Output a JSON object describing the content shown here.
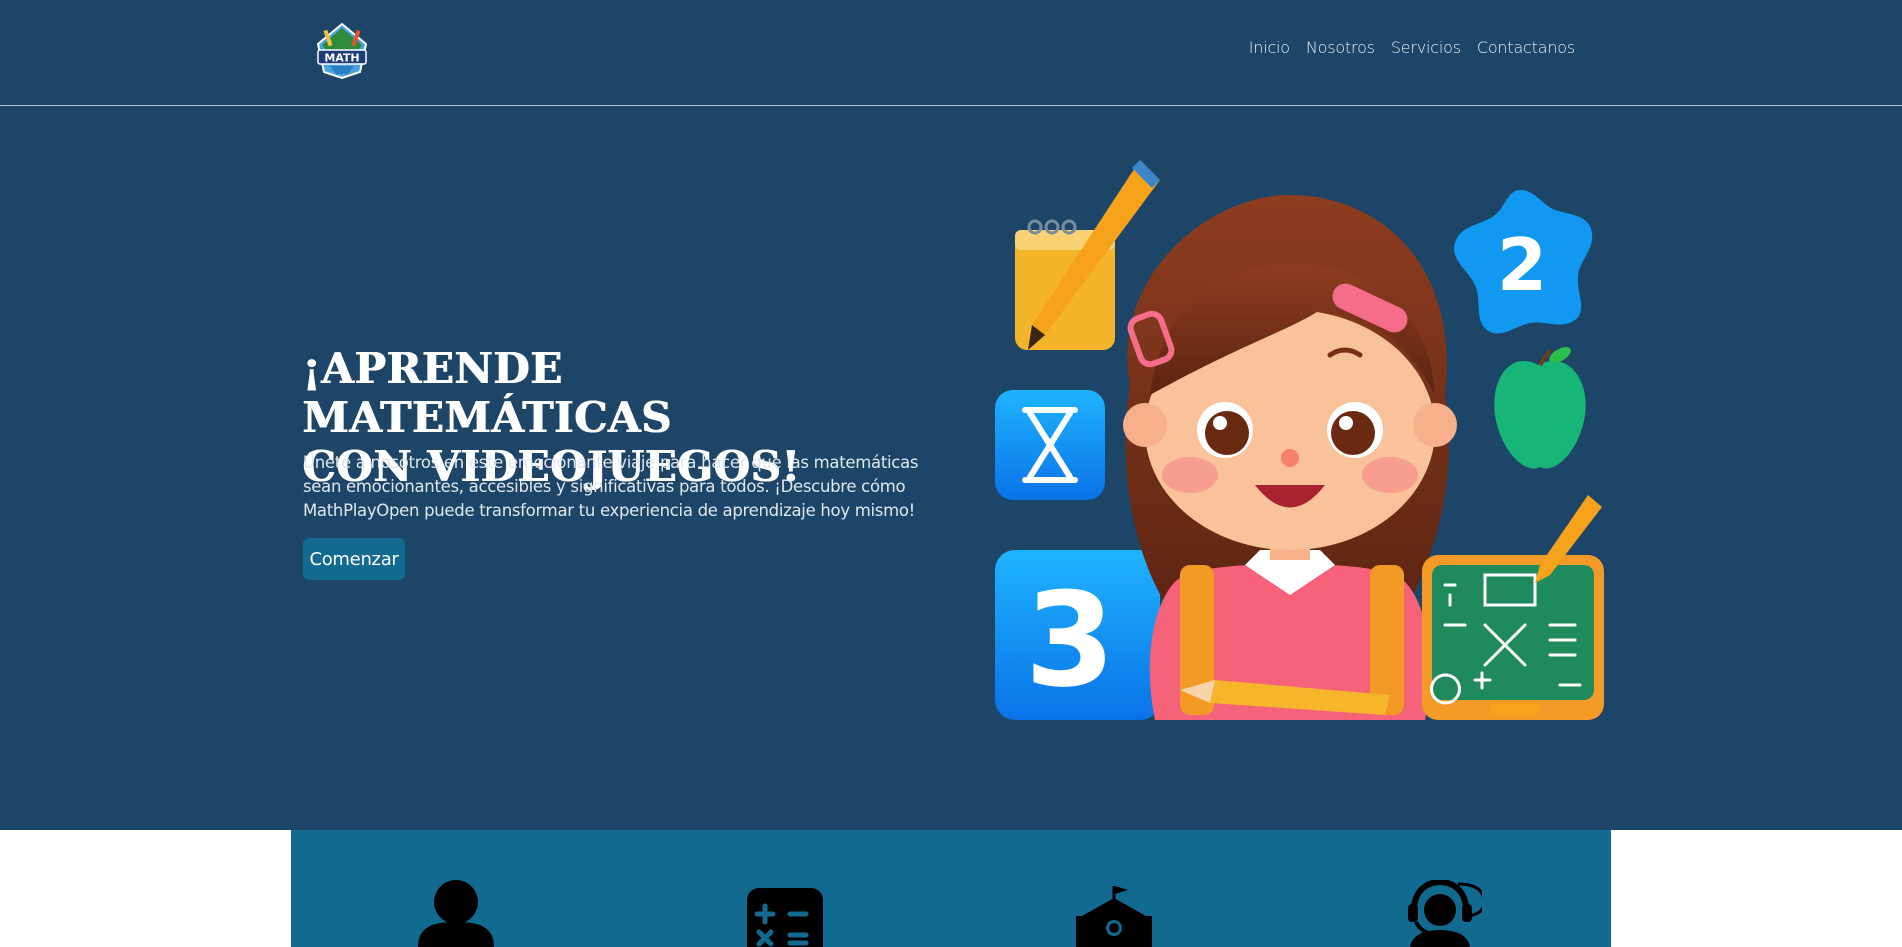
{
  "nav": {
    "logo_text": "MATH",
    "links": [
      "Inicio",
      "Nosotros",
      "Servicios",
      "Contactanos"
    ]
  },
  "hero": {
    "headline_line1": "¡APRENDE MATEMÁTICAS",
    "headline_line2": "CON VIDEOJUEGOS!",
    "description": "Únete a nosotros en este emocionante viaje para hacer que las matemáticas sean emocionantes, accesibles y significativas para todos. ¡Descubre cómo MathPlayOpen puede transformar tu experiencia de aprendizaje hoy mismo!",
    "cta_label": "Comenzar",
    "illustration_numbers": [
      "2",
      "3"
    ]
  },
  "services": {
    "icons": [
      "person-icon",
      "calculator-icon",
      "school-icon",
      "support-agent-icon"
    ]
  },
  "colors": {
    "hero_bg": "#1d4568",
    "accent": "#136a90",
    "band": "#136a90"
  }
}
